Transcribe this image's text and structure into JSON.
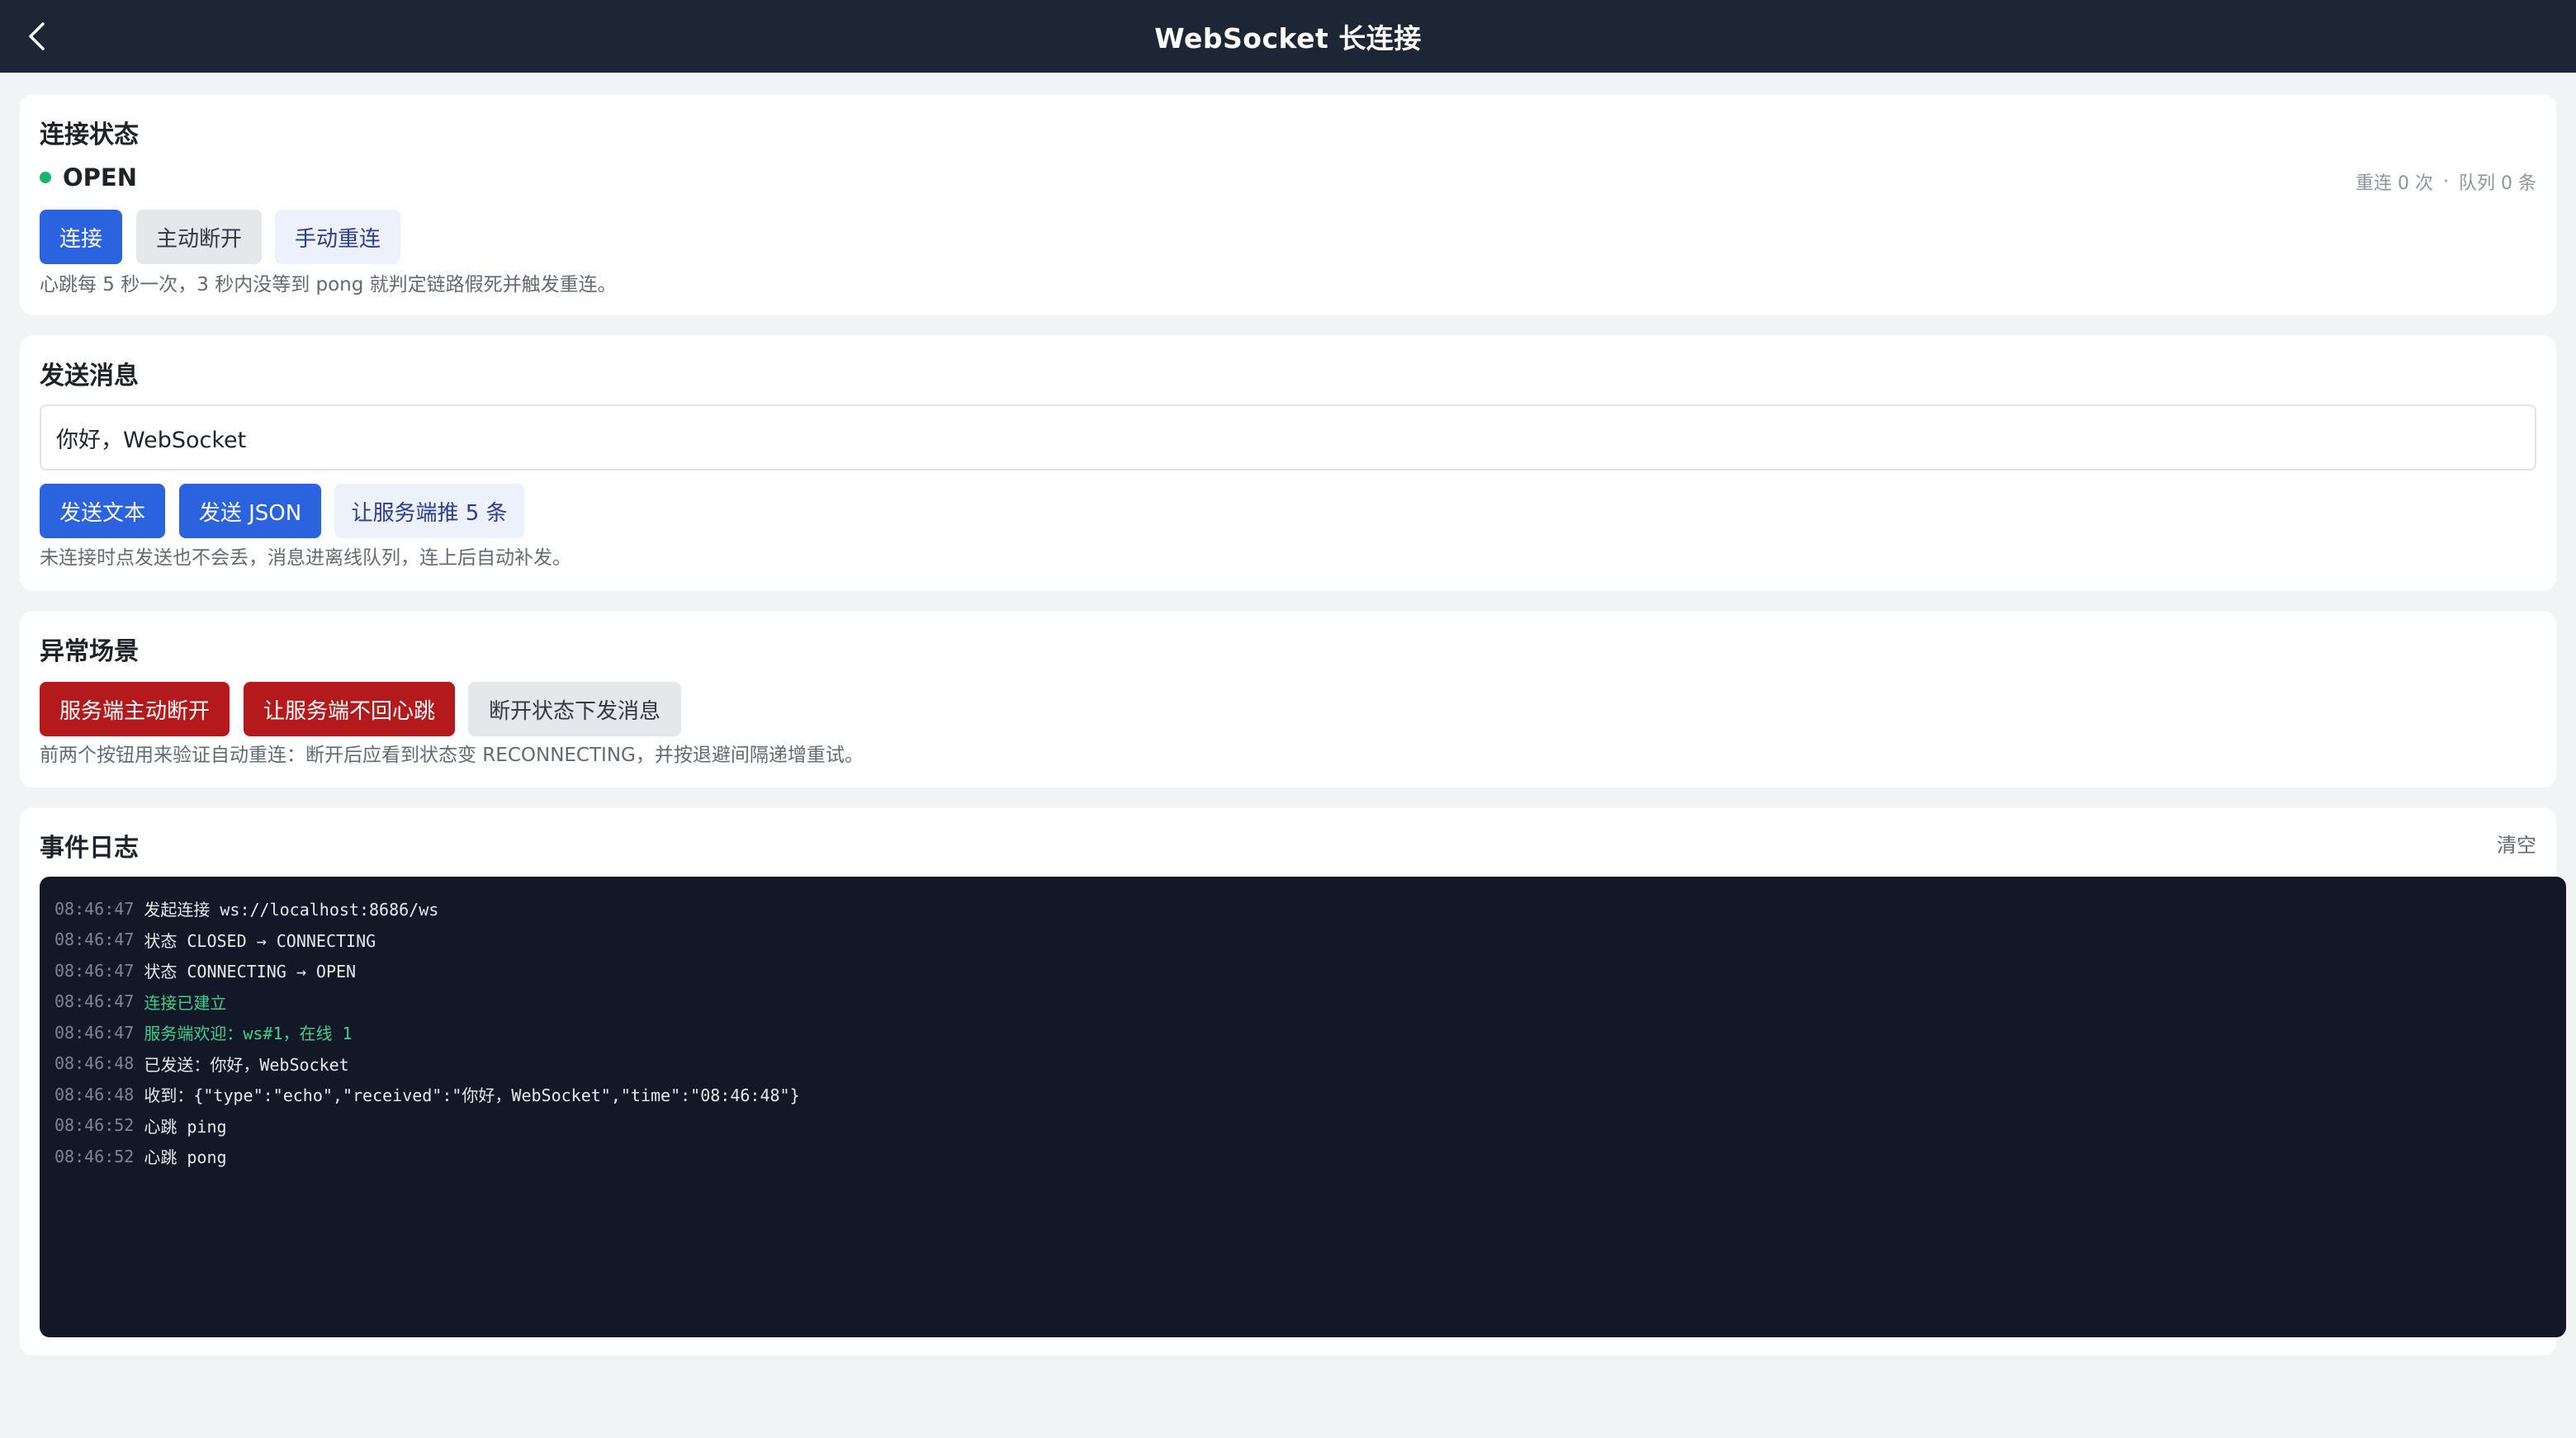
{
  "header": {
    "title": "WebSocket 长连接",
    "back_icon": "chevron-left-icon"
  },
  "connection": {
    "title": "连接状态",
    "status": "OPEN",
    "status_color": "#19b46a",
    "stats": {
      "reconnect": "重连 0 次",
      "separator": "·",
      "queue": "队列 0 条"
    },
    "buttons": {
      "connect": "连接",
      "disconnect": "主动断开",
      "reconnect": "手动重连"
    },
    "hint": "心跳每 5 秒一次，3 秒内没等到 pong 就判定链路假死并触发重连。"
  },
  "send": {
    "title": "发送消息",
    "input_value": "你好，WebSocket",
    "buttons": {
      "send_text": "发送文本",
      "send_json": "发送 JSON",
      "server_push": "让服务端推 5 条"
    },
    "hint": "未连接时点发送也不会丢，消息进离线队列，连上后自动补发。"
  },
  "abnormal": {
    "title": "异常场景",
    "buttons": {
      "server_close": "服务端主动断开",
      "no_heartbeat": "让服务端不回心跳",
      "send_offline": "断开状态下发消息"
    },
    "hint": "前两个按钮用来验证自动重连：断开后应看到状态变 RECONNECTING，并按退避间隔递增重试。"
  },
  "log": {
    "title": "事件日志",
    "clear_label": "清空",
    "entries": [
      {
        "time": "08:46:47",
        "text": "发起连接 ws://localhost:8686/ws",
        "style": "normal"
      },
      {
        "time": "08:46:47",
        "text": "状态 CLOSED → CONNECTING",
        "style": "normal"
      },
      {
        "time": "08:46:47",
        "text": "状态 CONNECTING → OPEN",
        "style": "normal"
      },
      {
        "time": "08:46:47",
        "text": "连接已建立",
        "style": "ok"
      },
      {
        "time": "08:46:47",
        "text": "服务端欢迎：ws#1，在线 1",
        "style": "ok"
      },
      {
        "time": "08:46:48",
        "text": "已发送：你好，WebSocket",
        "style": "normal"
      },
      {
        "time": "08:46:48",
        "text": "收到：{\"type\":\"echo\",\"received\":\"你好，WebSocket\",\"time\":\"08:46:48\"}",
        "style": "normal"
      },
      {
        "time": "08:46:52",
        "text": "心跳 ping",
        "style": "normal"
      },
      {
        "time": "08:46:52",
        "text": "心跳 pong",
        "style": "normal"
      }
    ]
  }
}
